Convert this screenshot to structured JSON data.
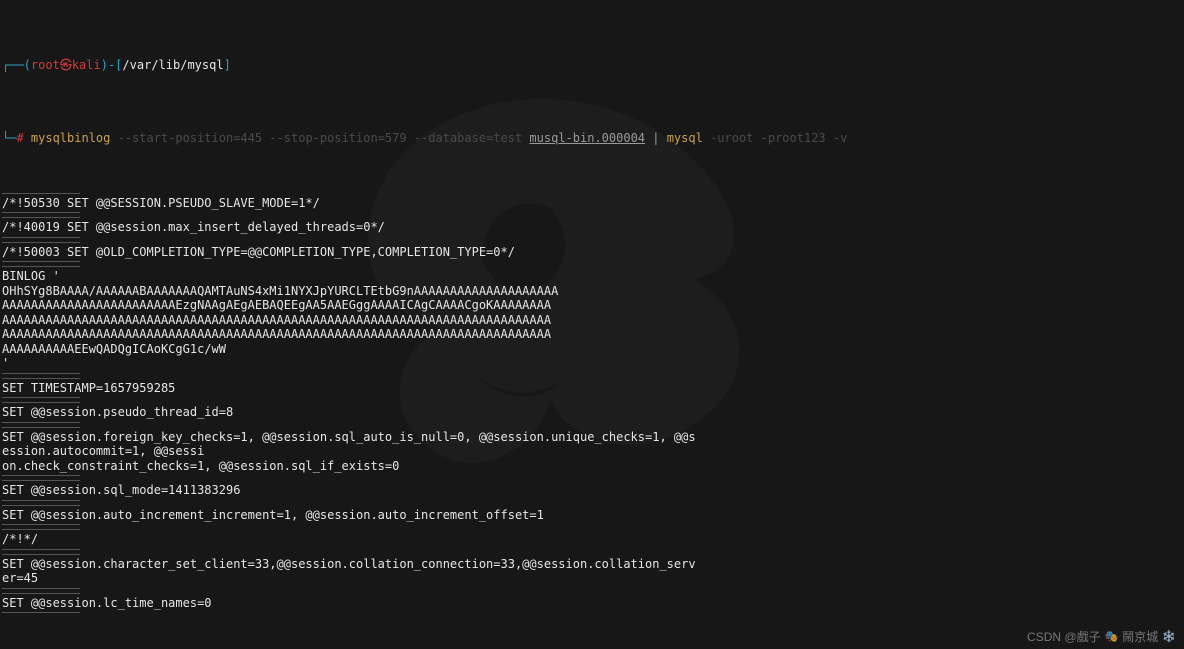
{
  "prompt": {
    "l1_open": "┌──(",
    "user": "root",
    "at": "㉿",
    "host": "kali",
    "l1_close": ")-[",
    "cwd": "/var/lib/mysql",
    "l1_end": "]",
    "l2_open": "└─",
    "hash": "#"
  },
  "command": {
    "bin": " mysqlbinlog",
    "args1": " --start-position=445 --stop-position=579 --database=test ",
    "binfile": "musql-bin.000004",
    "pipe": " | ",
    "mysql": "mysql",
    "args2": " -uroot -proot123 -v"
  },
  "blocks": [
    "/*!50530 SET @@SESSION.PSEUDO_SLAVE_MODE=1*/",
    "/*!40019 SET @@session.max_insert_delayed_threads=0*/",
    "/*!50003 SET @OLD_COMPLETION_TYPE=@@COMPLETION_TYPE,COMPLETION_TYPE=0*/",
    "BINLOG '\nOHhSYg8BAAAA/AAAAAABAAAAAAAQAMTAuNS4xMi1NYXJpYURCLTEtbG9nAAAAAAAAAAAAAAAAAAAA\nAAAAAAAAAAAAAAAAAAAAAAAAEzgNAAgAEgAEBAQEEgAA5AAEGggAAAAICAgCAAAACgoKAAAAAAAA\nAAAAAAAAAAAAAAAAAAAAAAAAAAAAAAAAAAAAAAAAAAAAAAAAAAAAAAAAAAAAAAAAAAAAAAAAAAAA\nAAAAAAAAAAAAAAAAAAAAAAAAAAAAAAAAAAAAAAAAAAAAAAAAAAAAAAAAAAAAAAAAAAAAAAAAAAAA\nAAAAAAAAAAEEwQADQgICAoKCgG1c/wW\n'",
    "SET TIMESTAMP=1657959285",
    "SET @@session.pseudo_thread_id=8",
    "SET @@session.foreign_key_checks=1, @@session.sql_auto_is_null=0, @@session.unique_checks=1, @@session.autocommit=1, @@sessi\non.check_constraint_checks=1, @@session.sql_if_exists=0",
    "SET @@session.sql_mode=1411383296",
    "SET @@session.auto_increment_increment=1, @@session.auto_increment_offset=1",
    "/*!*/",
    "SET @@session.character_set_client=33,@@session.collation_connection=33,@@session.collation_server=45",
    "SET @@session.lc_time_names=0"
  ],
  "watermark": {
    "left": "CSDN @戲子",
    "right": "鬧京城"
  }
}
